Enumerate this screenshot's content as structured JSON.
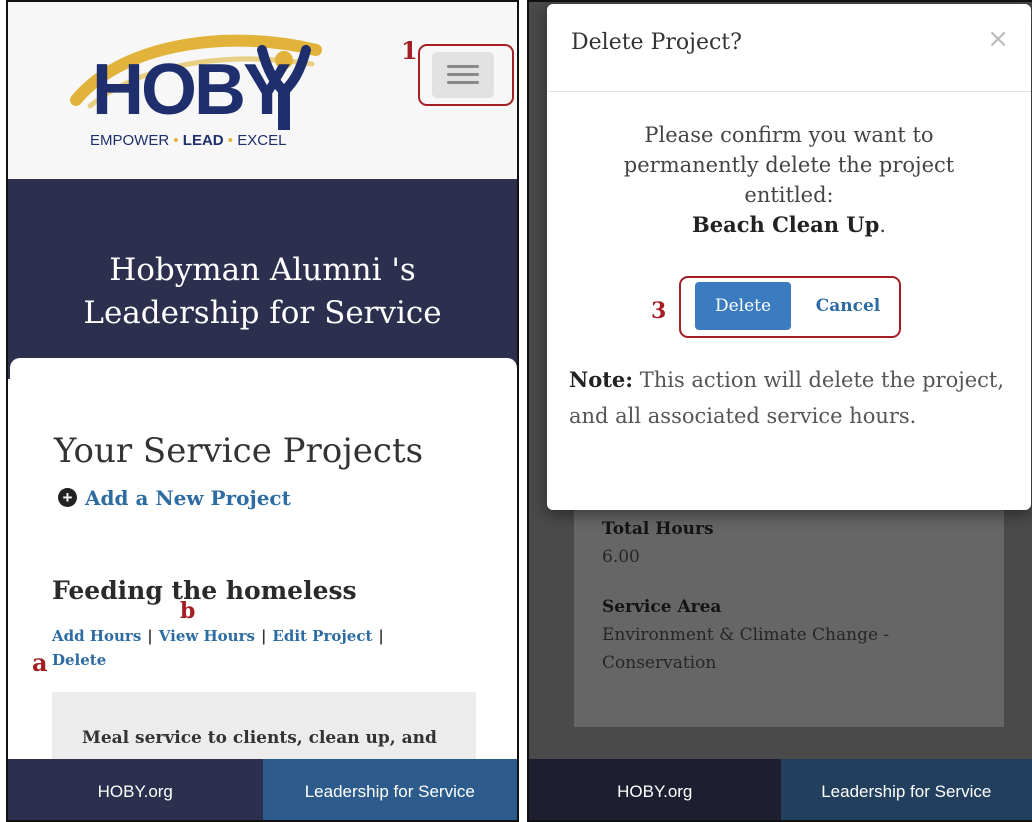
{
  "left": {
    "logo": {
      "word": "HOBY",
      "tag_1": "EMPOWER",
      "tag_2": "LEAD",
      "tag_3": "EXCEL",
      "dot": "•"
    },
    "callout_1": "1",
    "callout_a": "a",
    "callout_b": "b",
    "banner_title_line1": "Hobyman Alumni 's",
    "banner_title_line2": "Leadership for Service",
    "section_title": "Your Service Projects",
    "add_project_label": "Add a New Project",
    "add_icon": "plus-circle-icon",
    "project": {
      "title": "Feeding the homeless",
      "actions": [
        "Add Hours",
        "View Hours",
        "Edit Project",
        "Delete"
      ],
      "separator": "|",
      "description": "Meal service to clients, clean up, and"
    },
    "menu_icon": "hamburger-menu-icon"
  },
  "footer": {
    "link1": "HOBY.org",
    "link2": "Leadership for Service"
  },
  "right": {
    "modal": {
      "title": "Delete Project?",
      "close_glyph": "×",
      "confirm_text": "Please confirm you want to permanently delete the project entitled:",
      "project_name": "Beach Clean Up",
      "period": ".",
      "delete_label": "Delete",
      "cancel_label": "Cancel",
      "note_label": "Note:",
      "note_text": " This action will delete the project, and all associated service hours."
    },
    "callout_3": "3",
    "card": {
      "total_hours_label": "Total Hours",
      "total_hours_value": "6.00",
      "service_area_label": "Service Area",
      "service_area_value": "Environment & Climate Change - Conservation"
    }
  },
  "colors": {
    "navy": "#2c2f4e",
    "link_blue": "#2d6ca3",
    "button_blue": "#3b7bbf",
    "footer_blue": "#2d5c8c",
    "callout_red": "#a31f24",
    "logo_gold": "#e2b33a",
    "logo_navy": "#1f2f6e"
  }
}
